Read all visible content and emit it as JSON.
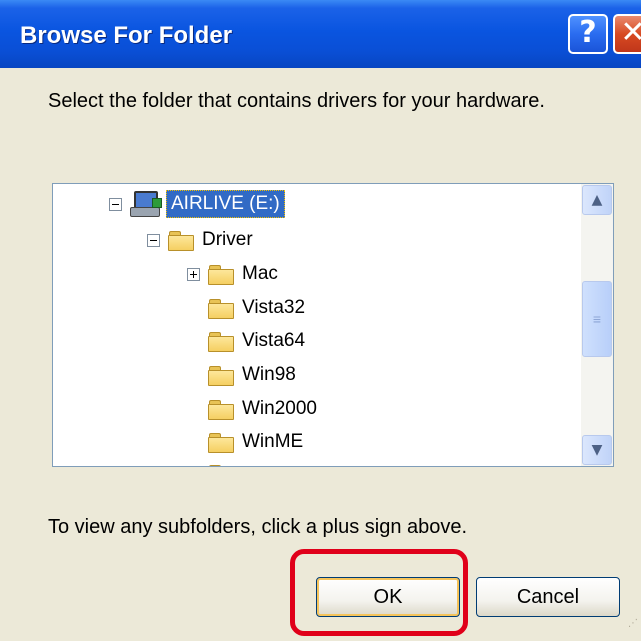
{
  "window": {
    "title": "Browse For Folder",
    "help_glyph": "?",
    "close_glyph": "✕"
  },
  "instruction": "Select the folder that contains drivers for your hardware.",
  "tree": {
    "items": [
      {
        "label": "AIRLIVE (E:)",
        "icon": "removable-drive-icon",
        "expander": "minus",
        "selected": true
      },
      {
        "label": "Driver",
        "icon": "folder-icon",
        "expander": "minus"
      },
      {
        "label": "Mac",
        "icon": "folder-icon",
        "expander": "plus"
      },
      {
        "label": "Vista32",
        "icon": "folder-icon"
      },
      {
        "label": "Vista64",
        "icon": "folder-icon"
      },
      {
        "label": "Win98",
        "icon": "folder-icon"
      },
      {
        "label": "Win2000",
        "icon": "folder-icon"
      },
      {
        "label": "WinME",
        "icon": "folder-icon"
      }
    ]
  },
  "scrollbar": {
    "up_glyph": "▲",
    "down_glyph": "▼",
    "thumb_glyph": "≡"
  },
  "hint": "To view any subfolders, click a plus sign above.",
  "buttons": {
    "ok": "OK",
    "cancel": "Cancel"
  },
  "colors": {
    "titlebar": "#0a55e0",
    "selection": "#316ac5",
    "highlight_ring": "#e0001a",
    "dialog_background": "#ece9d8"
  }
}
